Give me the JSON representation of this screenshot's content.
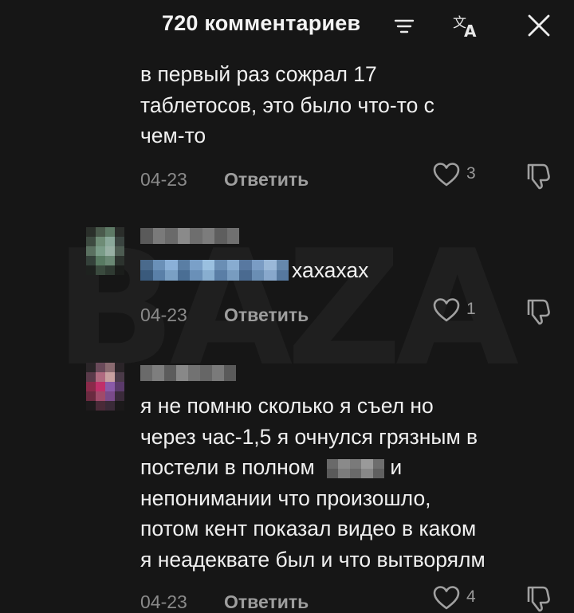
{
  "header": {
    "title": "720 комментариев",
    "sort_icon": "sort-icon",
    "translate_icon": "translate-icon",
    "close_icon": "close-icon"
  },
  "watermark": {
    "text": "BAZA"
  },
  "comments": [
    {
      "lines": [
        "в первый раз сожрал 17",
        "таблетосов, это было что-то с",
        "чем-то"
      ],
      "date": "04-23",
      "reply_label": "Ответить",
      "likes": "3"
    },
    {
      "mention_suffix": "хахахах",
      "date": "04-23",
      "reply_label": "Ответить",
      "likes": "1"
    },
    {
      "lines": [
        "я не помню сколько я съел но",
        "через час-1,5 я очнулся грязным в",
        "постели в полном",
        "непонимании что произошло,",
        "потом кент показал видео в каком",
        "я неадеквате был и что вытворялм"
      ],
      "line3_suffix": "и",
      "date": "04-23",
      "reply_label": "Ответить",
      "likes": "4"
    }
  ],
  "colors": {
    "background": "#161616",
    "text": "#f0f0f0",
    "meta": "#8a8a8a"
  }
}
